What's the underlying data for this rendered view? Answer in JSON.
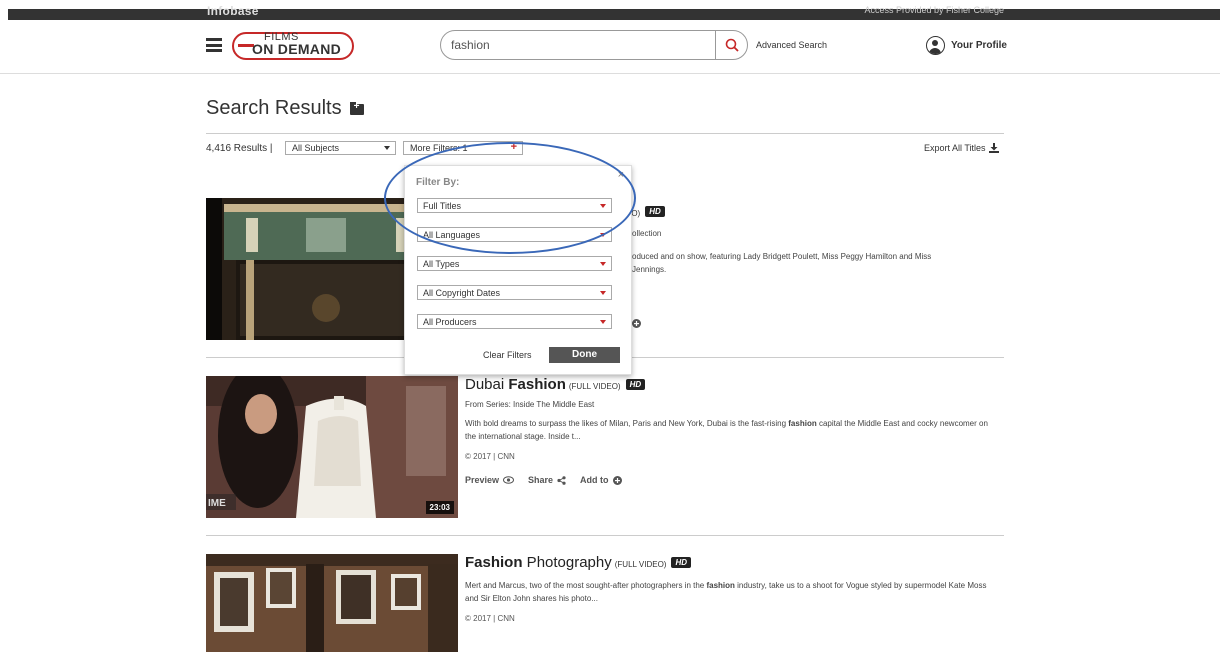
{
  "topbar": {
    "brand": "Infobase",
    "access": "Access Provided by Fisher College"
  },
  "header": {
    "logo_top": "FILMS",
    "logo_bottom": "ON DEMAND",
    "search_value": "fashion",
    "advanced_search": "Advanced Search",
    "profile": "Your Profile"
  },
  "page": {
    "title": "Search Results",
    "results_count": "4,416 Results |",
    "subjects": "All Subjects",
    "more_filters": "More Filters: 1",
    "export": "Export All Titles"
  },
  "filter_popover": {
    "title": "Filter By:",
    "close": "×",
    "options": [
      "Full Titles",
      "All Languages",
      "All Types",
      "All Copyright Dates",
      "All Producers"
    ],
    "clear": "Clear Filters",
    "done": "Done"
  },
  "results": [
    {
      "title_tail": "EO)",
      "series_tail": "ollection",
      "desc_line1": "oduced and on show, featuring Lady Bridgett Poulett, Miss Peggy Hamilton and Miss",
      "desc_line2": "Jennings.",
      "hd": "HD"
    },
    {
      "title_pre": "Dubai ",
      "title_bold": "Fashion",
      "title_post": "",
      "kind": "(FULL VIDEO)",
      "hd": "HD",
      "series": "From Series: Inside The Middle East",
      "desc_a": "With bold dreams to surpass the likes of Milan, Paris and New York, Dubai is the fast-rising ",
      "desc_bold": "fashion",
      "desc_b": " capital the Middle East and cocky newcomer on the international stage. Inside t...",
      "meta": "© 2017 | CNN",
      "duration": "23:03",
      "preview": "Preview",
      "share": "Share",
      "add_to": "Add to"
    },
    {
      "title_pre": "",
      "title_bold": "Fashion",
      "title_post": " Photography",
      "kind": "(FULL VIDEO)",
      "hd": "HD",
      "desc_a": "Mert and Marcus, two of the most sought-after photographers in the ",
      "desc_bold": "fashion",
      "desc_b": " industry, take us to a shoot for Vogue styled by supermodel Kate Moss and Sir Elton John shares his photo...",
      "meta": "© 2017 | CNN"
    }
  ],
  "colors": {
    "accent": "#c62828",
    "annotation": "#3a68b8",
    "done_bg": "#555555"
  }
}
